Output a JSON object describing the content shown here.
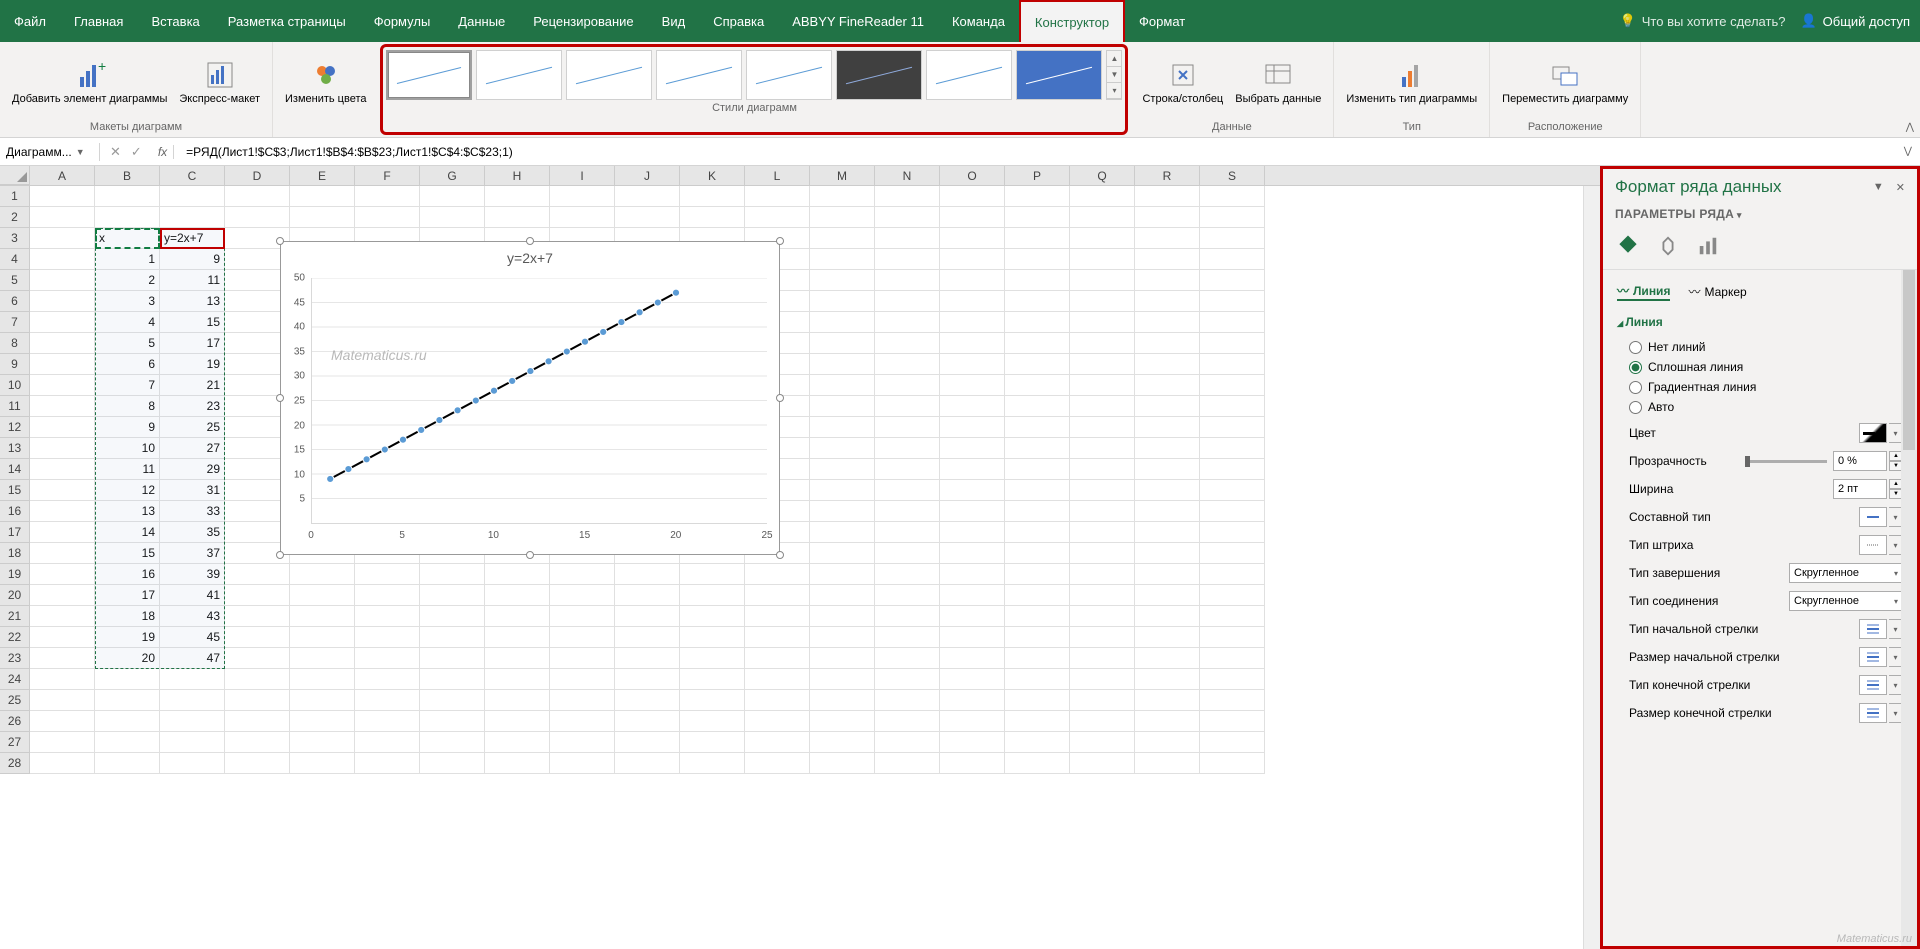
{
  "titlebar": {
    "tabs": [
      "Файл",
      "Главная",
      "Вставка",
      "Разметка страницы",
      "Формулы",
      "Данные",
      "Рецензирование",
      "Вид",
      "Справка",
      "ABBYY FineReader 11",
      "Команда",
      "Конструктор",
      "Формат"
    ],
    "active_tab": "Конструктор",
    "tell_me": "Что вы хотите сделать?",
    "share": "Общий доступ"
  },
  "ribbon": {
    "add_element": "Добавить элемент диаграммы",
    "quick_layout": "Экспресс-макет",
    "layouts_group": "Макеты диаграмм",
    "change_colors": "Изменить цвета",
    "styles_group": "Стили диаграмм",
    "switch_rc": "Строка/столбец",
    "select_data": "Выбрать данные",
    "data_group": "Данные",
    "change_type": "Изменить тип диаграммы",
    "type_group": "Тип",
    "move_chart": "Переместить диаграмму",
    "location_group": "Расположение"
  },
  "formula_bar": {
    "name_box": "Диаграмм...",
    "formula": "=РЯД(Лист1!$C$3;Лист1!$B$4:$B$23;Лист1!$C$4:$C$23;1)"
  },
  "columns": [
    "A",
    "B",
    "C",
    "D",
    "E",
    "F",
    "G",
    "H",
    "I",
    "J",
    "K",
    "L",
    "M",
    "N",
    "O",
    "P",
    "Q",
    "R",
    "S"
  ],
  "rows": [
    1,
    2,
    3,
    4,
    5,
    6,
    7,
    8,
    9,
    10,
    11,
    12,
    13,
    14,
    15,
    16,
    17,
    18,
    19,
    20,
    21,
    22,
    23,
    24,
    25,
    26,
    27,
    28
  ],
  "table": {
    "header_b": "x",
    "header_c": "y=2x+7",
    "data": [
      {
        "x": 1,
        "y": 9
      },
      {
        "x": 2,
        "y": 11
      },
      {
        "x": 3,
        "y": 13
      },
      {
        "x": 4,
        "y": 15
      },
      {
        "x": 5,
        "y": 17
      },
      {
        "x": 6,
        "y": 19
      },
      {
        "x": 7,
        "y": 21
      },
      {
        "x": 8,
        "y": 23
      },
      {
        "x": 9,
        "y": 25
      },
      {
        "x": 10,
        "y": 27
      },
      {
        "x": 11,
        "y": 29
      },
      {
        "x": 12,
        "y": 31
      },
      {
        "x": 13,
        "y": 33
      },
      {
        "x": 14,
        "y": 35
      },
      {
        "x": 15,
        "y": 37
      },
      {
        "x": 16,
        "y": 39
      },
      {
        "x": 17,
        "y": 41
      },
      {
        "x": 18,
        "y": 43
      },
      {
        "x": 19,
        "y": 45
      },
      {
        "x": 20,
        "y": 47
      }
    ]
  },
  "chart": {
    "title": "y=2x+7",
    "watermark": "Matematicus.ru",
    "y_ticks": [
      5,
      10,
      15,
      20,
      25,
      30,
      35,
      40,
      45,
      50
    ],
    "x_ticks": [
      0,
      5,
      10,
      15,
      20,
      25
    ]
  },
  "chart_data": {
    "type": "line",
    "title": "y=2x+7",
    "xlabel": "",
    "ylabel": "",
    "xlim": [
      0,
      25
    ],
    "ylim": [
      0,
      50
    ],
    "x": [
      1,
      2,
      3,
      4,
      5,
      6,
      7,
      8,
      9,
      10,
      11,
      12,
      13,
      14,
      15,
      16,
      17,
      18,
      19,
      20
    ],
    "series": [
      {
        "name": "y=2x+7",
        "values": [
          9,
          11,
          13,
          15,
          17,
          19,
          21,
          23,
          25,
          27,
          29,
          31,
          33,
          35,
          37,
          39,
          41,
          43,
          45,
          47
        ]
      }
    ],
    "marker": "circle",
    "line_color": "#000000",
    "marker_color": "#5b9bd5"
  },
  "format_pane": {
    "title": "Формат ряда данных",
    "subtitle": "Параметры ряда",
    "tab_line": "Линия",
    "tab_marker": "Маркер",
    "section_line": "Линия",
    "radio_none": "Нет линий",
    "radio_solid": "Сплошная линия",
    "radio_gradient": "Градиентная линия",
    "radio_auto": "Авто",
    "selected_radio": "Сплошная линия",
    "prop_color": "Цвет",
    "prop_transparency": "Прозрачность",
    "transparency_value": "0 %",
    "prop_width": "Ширина",
    "width_value": "2 пт",
    "prop_compound": "Составной тип",
    "prop_dash": "Тип штриха",
    "prop_cap": "Тип завершения",
    "cap_value": "Скругленное",
    "prop_join": "Тип соединения",
    "join_value": "Скругленное",
    "prop_begin_arrow": "Тип начальной стрелки",
    "prop_begin_size": "Размер начальной стрелки",
    "prop_end_arrow": "Тип конечной стрелки",
    "prop_end_size": "Размер конечной стрелки"
  },
  "watermark_bottom": "Matematicus.ru"
}
